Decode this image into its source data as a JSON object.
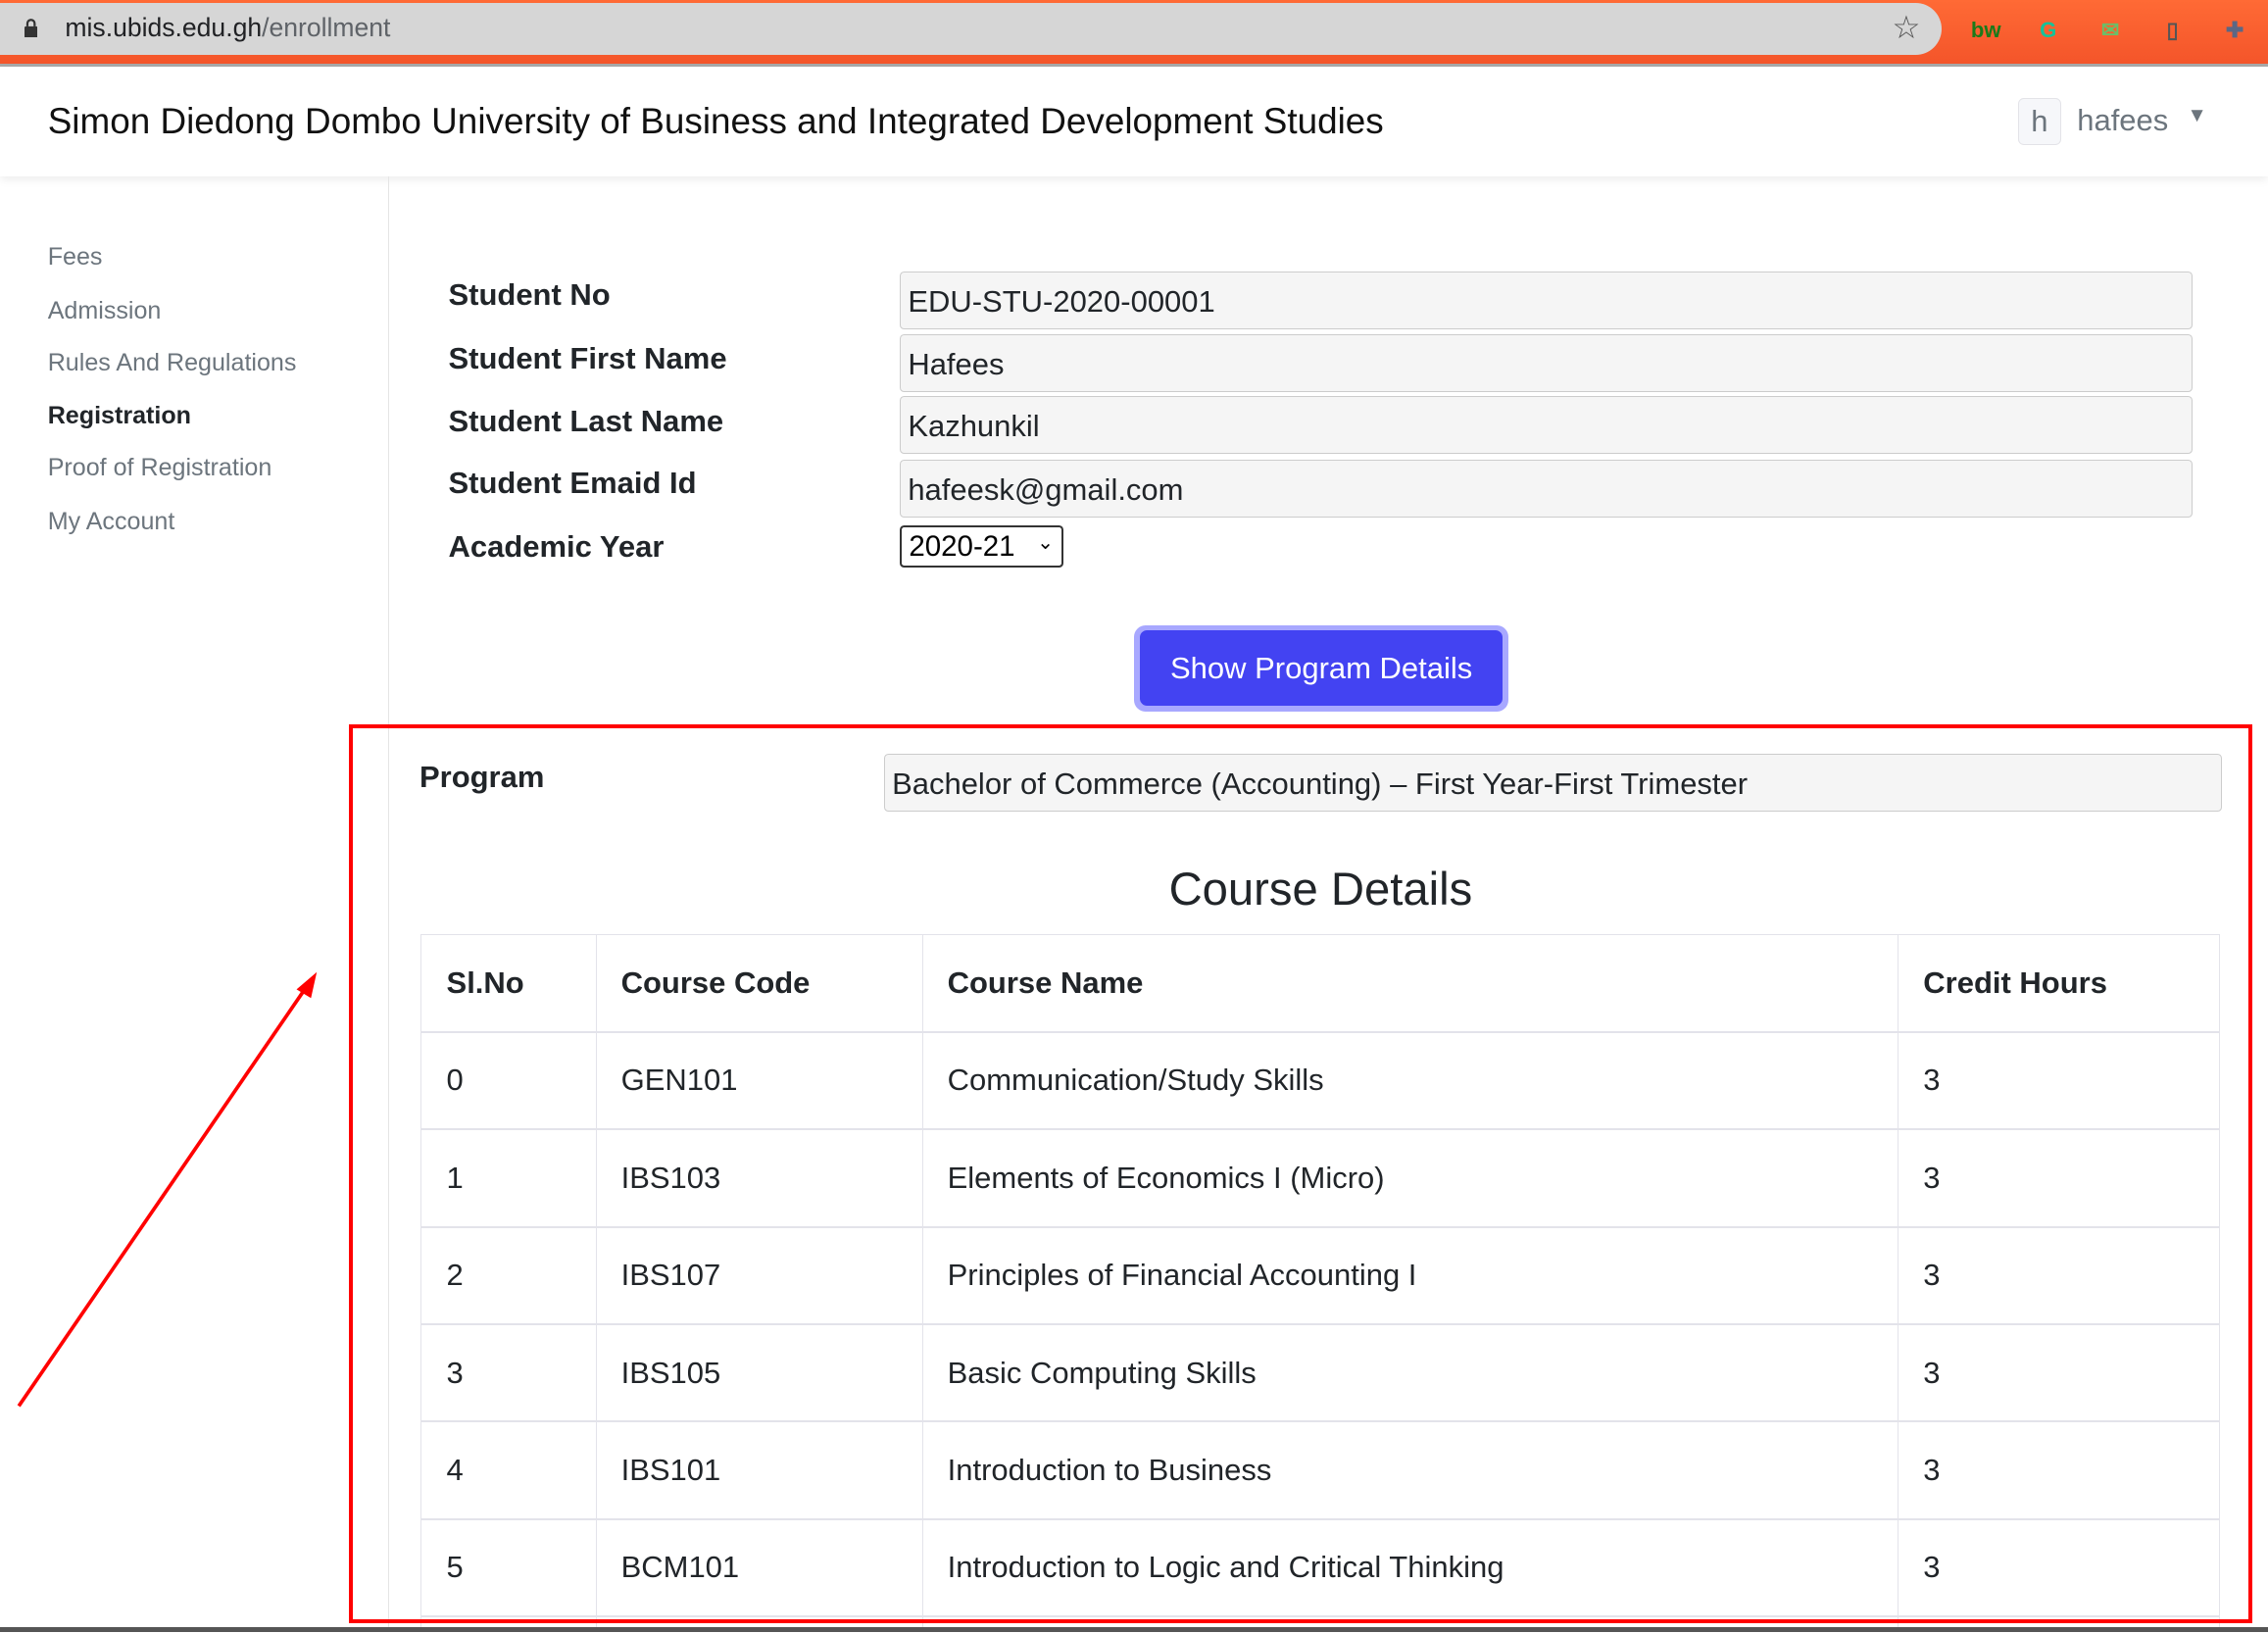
{
  "browser": {
    "url_host": "mis.ubids.edu.gh",
    "url_path": "/enrollment",
    "extensions": [
      {
        "name": "bw-extension-icon",
        "text": "bw",
        "color": "#1a7a1a"
      },
      {
        "name": "grammarly-icon",
        "text": "G",
        "color": "#15c39a"
      },
      {
        "name": "mail-tracker-icon",
        "text": "✉",
        "color": "#6abf69"
      },
      {
        "name": "document-icon",
        "text": "▯",
        "color": "#555555"
      },
      {
        "name": "extensions-puzzle-icon",
        "text": "✚",
        "color": "#5b6784"
      }
    ],
    "accent": "#f4552a"
  },
  "header": {
    "title": "Simon Diedong Dombo University of Business and Integrated Development Studies",
    "user_initial": "h",
    "user_name": "hafees"
  },
  "sidebar": {
    "items": [
      {
        "label": "Fees",
        "active": false
      },
      {
        "label": "Admission",
        "active": false
      },
      {
        "label": "Rules And Regulations",
        "active": false
      },
      {
        "label": "Registration",
        "active": true
      },
      {
        "label": "Proof of Registration",
        "active": false
      },
      {
        "label": "My Account",
        "active": false
      }
    ]
  },
  "form": {
    "student_no_label": "Student No",
    "student_no": "EDU-STU-2020-00001",
    "first_name_label": "Student First Name",
    "first_name": "Hafees",
    "last_name_label": "Student Last Name",
    "last_name": "Kazhunkil",
    "email_label": "Student Emaid Id",
    "email": "hafeesk@gmail.com",
    "year_label": "Academic Year",
    "year_selected": "2020-21",
    "show_button": "Show Program Details",
    "button_color": "#4343f2"
  },
  "program": {
    "label": "Program",
    "value": "Bachelor of Commerce (Accounting) – First Year-First Trimester"
  },
  "courses": {
    "title": "Course Details",
    "headers": [
      "Sl.No",
      "Course Code",
      "Course Name",
      "Credit Hours"
    ],
    "rows": [
      [
        "0",
        "GEN101",
        "Communication/Study Skills",
        "3"
      ],
      [
        "1",
        "IBS103",
        "Elements of Economics I (Micro)",
        "3"
      ],
      [
        "2",
        "IBS107",
        "Principles of Financial Accounting I",
        "3"
      ],
      [
        "3",
        "IBS105",
        "Basic Computing Skills",
        "3"
      ],
      [
        "4",
        "IBS101",
        "Introduction to Business",
        "3"
      ],
      [
        "5",
        "BCM101",
        "Introduction to Logic and Critical Thinking",
        "3"
      ],
      [
        "",
        "",
        "",
        ""
      ]
    ]
  },
  "annotation": {
    "highlight_color": "#ff0000"
  }
}
